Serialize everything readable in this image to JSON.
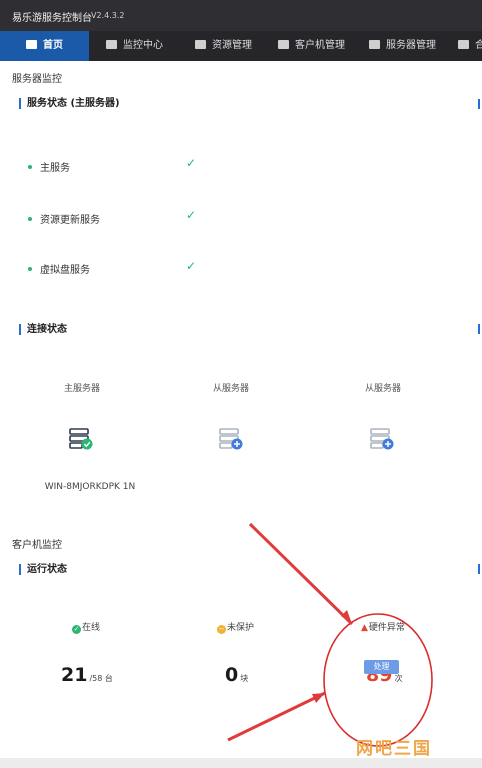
{
  "window": {
    "title": "易乐游服务控制台",
    "version": "V2.4.3.2"
  },
  "nav": {
    "items": [
      {
        "label": "首页",
        "icon": "home-icon"
      },
      {
        "label": "监控中心",
        "icon": "monitor-icon"
      },
      {
        "label": "资源管理",
        "icon": "resource-icon"
      },
      {
        "label": "客户机管理",
        "icon": "client-icon"
      },
      {
        "label": "服务器管理",
        "icon": "server-icon"
      },
      {
        "label": "合",
        "icon": "store-icon"
      }
    ]
  },
  "server_monitor": {
    "section_title": "服务器监控",
    "status_card": {
      "title": "服务状态 (主服务器)",
      "services": [
        {
          "label": "主服务",
          "status": "ok"
        },
        {
          "label": "资源更新服务",
          "status": "ok"
        },
        {
          "label": "虚拟盘服务",
          "status": "ok"
        }
      ]
    },
    "connection_card": {
      "title": "连接状态",
      "servers": [
        {
          "label": "主服务器",
          "name": "WIN-8MJORKDPK 1N",
          "state": "connected"
        },
        {
          "label": "从服务器",
          "name": "",
          "state": "add"
        },
        {
          "label": "从服务器",
          "name": "",
          "state": "add"
        }
      ]
    }
  },
  "client_monitor": {
    "section_title": "客户机监控",
    "run_card": {
      "title": "运行状态",
      "stats": [
        {
          "label": "在线",
          "value": "21",
          "unit": "/58 台"
        },
        {
          "label": "未保护",
          "value": "0",
          "unit": "块"
        },
        {
          "label": "硬件异常",
          "value": "89",
          "unit": "次"
        }
      ],
      "action_label": "处理"
    }
  },
  "watermark": "网吧三国",
  "colors": {
    "accent": "#1b5aa8",
    "ok": "#2bb673",
    "alert": "#e0452f",
    "annotation": "#e03a3a"
  }
}
